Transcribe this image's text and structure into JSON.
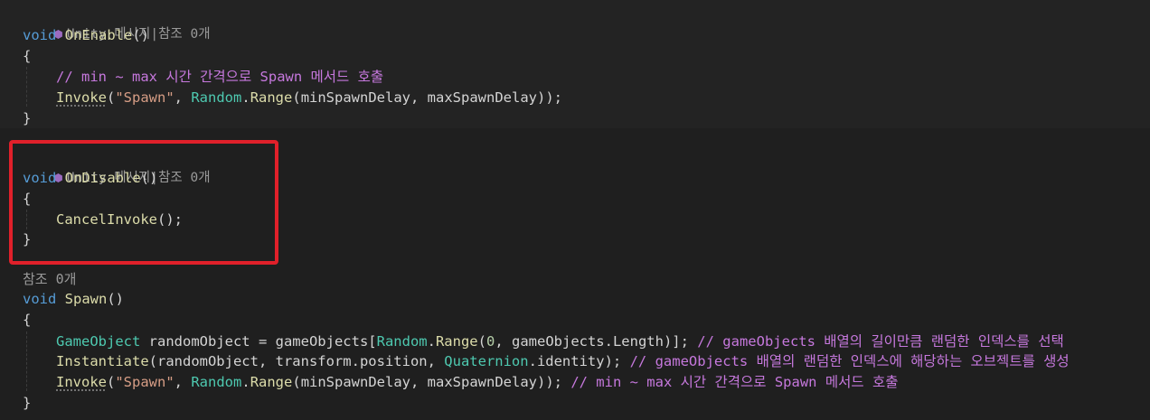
{
  "code_lens": {
    "block1": "Unity 메시지|참조 0개",
    "block2": "Unity 메시지|참조 0개",
    "block3": "참조 0개"
  },
  "onenable": {
    "void": "void",
    "name": "OnEnable",
    "parens": "()",
    "open": "{",
    "comment": "// min ~ max 시간 간격으로 Spawn 메서드 호출",
    "invoke": "Invoke",
    "p1": "(",
    "spawn_str": "\"Spawn\"",
    "comma1": ", ",
    "random": "Random",
    "dot": ".",
    "range": "Range",
    "args": "(minSpawnDelay, maxSpawnDelay));",
    "close": "}"
  },
  "ondisable": {
    "void": "void",
    "name": "OnDisable",
    "parens": "()",
    "open": "{",
    "cancel": "CancelInvoke",
    "cancel_tail": "();",
    "close": "}"
  },
  "spawn": {
    "void": "void",
    "name": "Spawn",
    "parens": "()",
    "open": "{",
    "line1": {
      "type": "GameObject",
      "decl": " randomObject = gameObjects[",
      "random": "Random",
      "dot": ".",
      "range": "Range",
      "p1": "(",
      "zero": "0",
      "rest": ", gameObjects.Length)]; ",
      "comment": "// gameObjects 배열의 길이만큼 랜덤한 인덱스를 선택"
    },
    "line2": {
      "fn": "Instantiate",
      "args": "(randomObject, transform.position, ",
      "type": "Quaternion",
      "tail": ".identity); ",
      "comment": "// gameObjects 배열의 랜덤한 인덱스에 해당하는 오브젝트를 생성"
    },
    "line3": {
      "invoke": "Invoke",
      "p1": "(",
      "spawn_str": "\"Spawn\"",
      "comma1": ", ",
      "random": "Random",
      "dot": ".",
      "range": "Range",
      "args": "(minSpawnDelay, maxSpawnDelay)); ",
      "comment": "// min ~ max 시간 간격으로 Spawn 메서드 호출"
    },
    "close": "}"
  },
  "colors": {
    "background": "#1f1f1f",
    "keyword": "#569cd6",
    "function": "#dcdcaa",
    "string": "#d69d85",
    "type": "#4ec9b0",
    "comment": "#c678dd",
    "highlight_border": "#e0202a"
  }
}
